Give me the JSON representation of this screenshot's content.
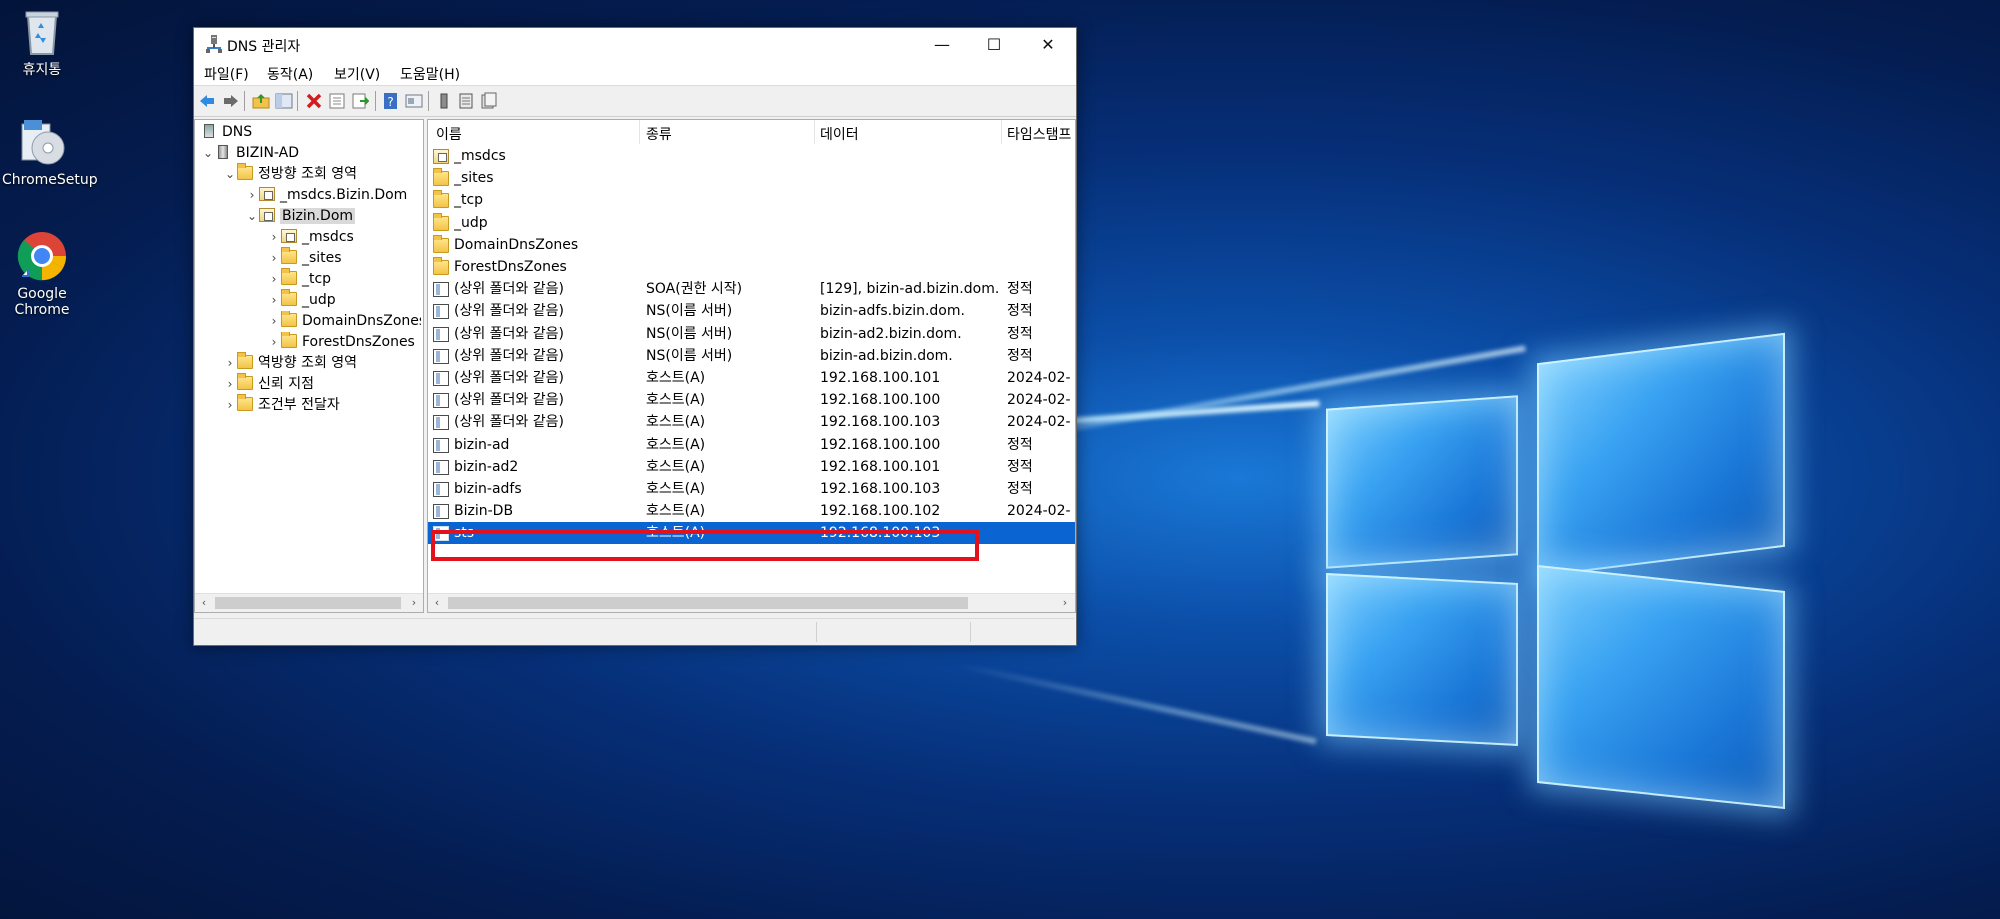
{
  "desktop": {
    "icons": [
      {
        "label": "휴지통",
        "icon": "recycle-bin-icon"
      },
      {
        "label": "ChromeSetup",
        "icon": "installer-icon"
      },
      {
        "label": "Google Chrome",
        "icon": "chrome-icon"
      }
    ]
  },
  "window": {
    "title": "DNS 관리자",
    "controls": {
      "minimize": "—",
      "maximize": "☐",
      "close": "✕"
    },
    "menu": [
      "파일(F)",
      "동작(A)",
      "보기(V)",
      "도움말(H)"
    ]
  },
  "tree": {
    "root": "DNS",
    "server": "BIZIN-AD",
    "forward_zones": "정방향 조회 영역",
    "zone_msdcs": "_msdcs.Bizin.Dom",
    "zone_bizin": "Bizin.Dom",
    "children": [
      "_msdcs",
      "_sites",
      "_tcp",
      "_udp",
      "DomainDnsZones",
      "ForestDnsZones"
    ],
    "reverse_zones": "역방향 조회 영역",
    "trust_points": "신뢰 지점",
    "conditional_forwarders": "조건부 전달자"
  },
  "list": {
    "columns": [
      "이름",
      "종류",
      "데이터",
      "타임스탬프"
    ],
    "rows": [
      {
        "name": "_msdcs",
        "type": "",
        "data": "",
        "ts": "",
        "icon": "zone"
      },
      {
        "name": "_sites",
        "type": "",
        "data": "",
        "ts": "",
        "icon": "folder"
      },
      {
        "name": "_tcp",
        "type": "",
        "data": "",
        "ts": "",
        "icon": "folder"
      },
      {
        "name": "_udp",
        "type": "",
        "data": "",
        "ts": "",
        "icon": "folder"
      },
      {
        "name": "DomainDnsZones",
        "type": "",
        "data": "",
        "ts": "",
        "icon": "folder"
      },
      {
        "name": "ForestDnsZones",
        "type": "",
        "data": "",
        "ts": "",
        "icon": "folder"
      },
      {
        "name": "(상위 폴더와 같음)",
        "type": "SOA(권한 시작)",
        "data": "[129], bizin-ad.bizin.dom...",
        "ts": "정적",
        "icon": "rec"
      },
      {
        "name": "(상위 폴더와 같음)",
        "type": "NS(이름 서버)",
        "data": "bizin-adfs.bizin.dom.",
        "ts": "정적",
        "icon": "rec"
      },
      {
        "name": "(상위 폴더와 같음)",
        "type": "NS(이름 서버)",
        "data": "bizin-ad2.bizin.dom.",
        "ts": "정적",
        "icon": "rec"
      },
      {
        "name": "(상위 폴더와 같음)",
        "type": "NS(이름 서버)",
        "data": "bizin-ad.bizin.dom.",
        "ts": "정적",
        "icon": "rec"
      },
      {
        "name": "(상위 폴더와 같음)",
        "type": "호스트(A)",
        "data": "192.168.100.101",
        "ts": "2024-02-",
        "icon": "rec"
      },
      {
        "name": "(상위 폴더와 같음)",
        "type": "호스트(A)",
        "data": "192.168.100.100",
        "ts": "2024-02-",
        "icon": "rec"
      },
      {
        "name": "(상위 폴더와 같음)",
        "type": "호스트(A)",
        "data": "192.168.100.103",
        "ts": "2024-02-",
        "icon": "rec"
      },
      {
        "name": "bizin-ad",
        "type": "호스트(A)",
        "data": "192.168.100.100",
        "ts": "정적",
        "icon": "rec"
      },
      {
        "name": "bizin-ad2",
        "type": "호스트(A)",
        "data": "192.168.100.101",
        "ts": "정적",
        "icon": "rec"
      },
      {
        "name": "bizin-adfs",
        "type": "호스트(A)",
        "data": "192.168.100.103",
        "ts": "정적",
        "icon": "rec"
      },
      {
        "name": "Bizin-DB",
        "type": "호스트(A)",
        "data": "192.168.100.102",
        "ts": "2024-02-",
        "icon": "rec"
      },
      {
        "name": "sts",
        "type": "호스트(A)",
        "data": "192.168.100.103",
        "ts": "",
        "icon": "rec",
        "selected": true
      }
    ]
  },
  "colors": {
    "selection": "#0a64d2",
    "highlight_box": "#e4101a"
  }
}
